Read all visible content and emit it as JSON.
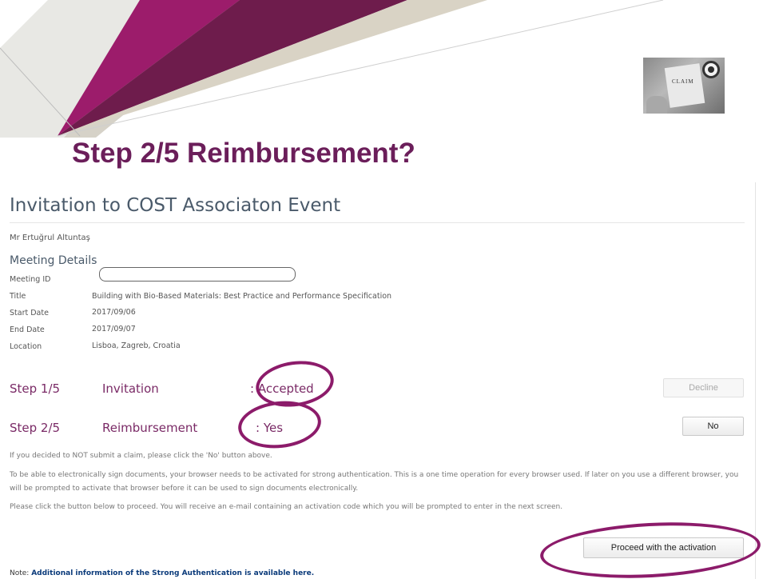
{
  "slide": {
    "title": "Step 2/5 Reimbursement?",
    "photo_text": "CLAIM",
    "accent_color": "#6b1e5a"
  },
  "page": {
    "heading": "Invitation to COST Associaton Event",
    "person": "Mr Ertuğrul Altuntaş",
    "section_title": "Meeting Details",
    "details": [
      {
        "label": "Meeting ID",
        "value": ""
      },
      {
        "label": "Title",
        "value": "Building with Bio-Based Materials: Best Practice and Performance Specification"
      },
      {
        "label": "Start Date",
        "value": "2017/09/06"
      },
      {
        "label": "End Date",
        "value": "2017/09/07"
      },
      {
        "label": "Location",
        "value": "Lisboa, Zagreb, Croatia"
      }
    ]
  },
  "steps": [
    {
      "number": "Step 1/5",
      "name": "Invitation",
      "status": ": Accepted",
      "button": "Decline"
    },
    {
      "number": "Step 2/5",
      "name": "Reimbursement",
      "status": ": Yes",
      "button": "No"
    }
  ],
  "text": {
    "no_claim": "If you decided to NOT submit a claim, please click the 'No' button above.",
    "sign_info": "To be able to electronically sign documents, your browser needs to be activated for strong authentication. This is a one time operation for every browser used. If later on you use a different browser, you will be prompted to activate that browser before it can be used to sign documents electronically.",
    "proceed_info": "Please click the button below to proceed. You will receive an e-mail containing an activation code which you will be prompted to enter in the next screen."
  },
  "activation_button": "Proceed with the activation",
  "note": {
    "prefix": "Note: ",
    "link": "Additional information of the Strong Authentication is available here."
  },
  "colors": {
    "step_purple": "#7a2a66",
    "ring_magenta": "#8c1b6a"
  }
}
